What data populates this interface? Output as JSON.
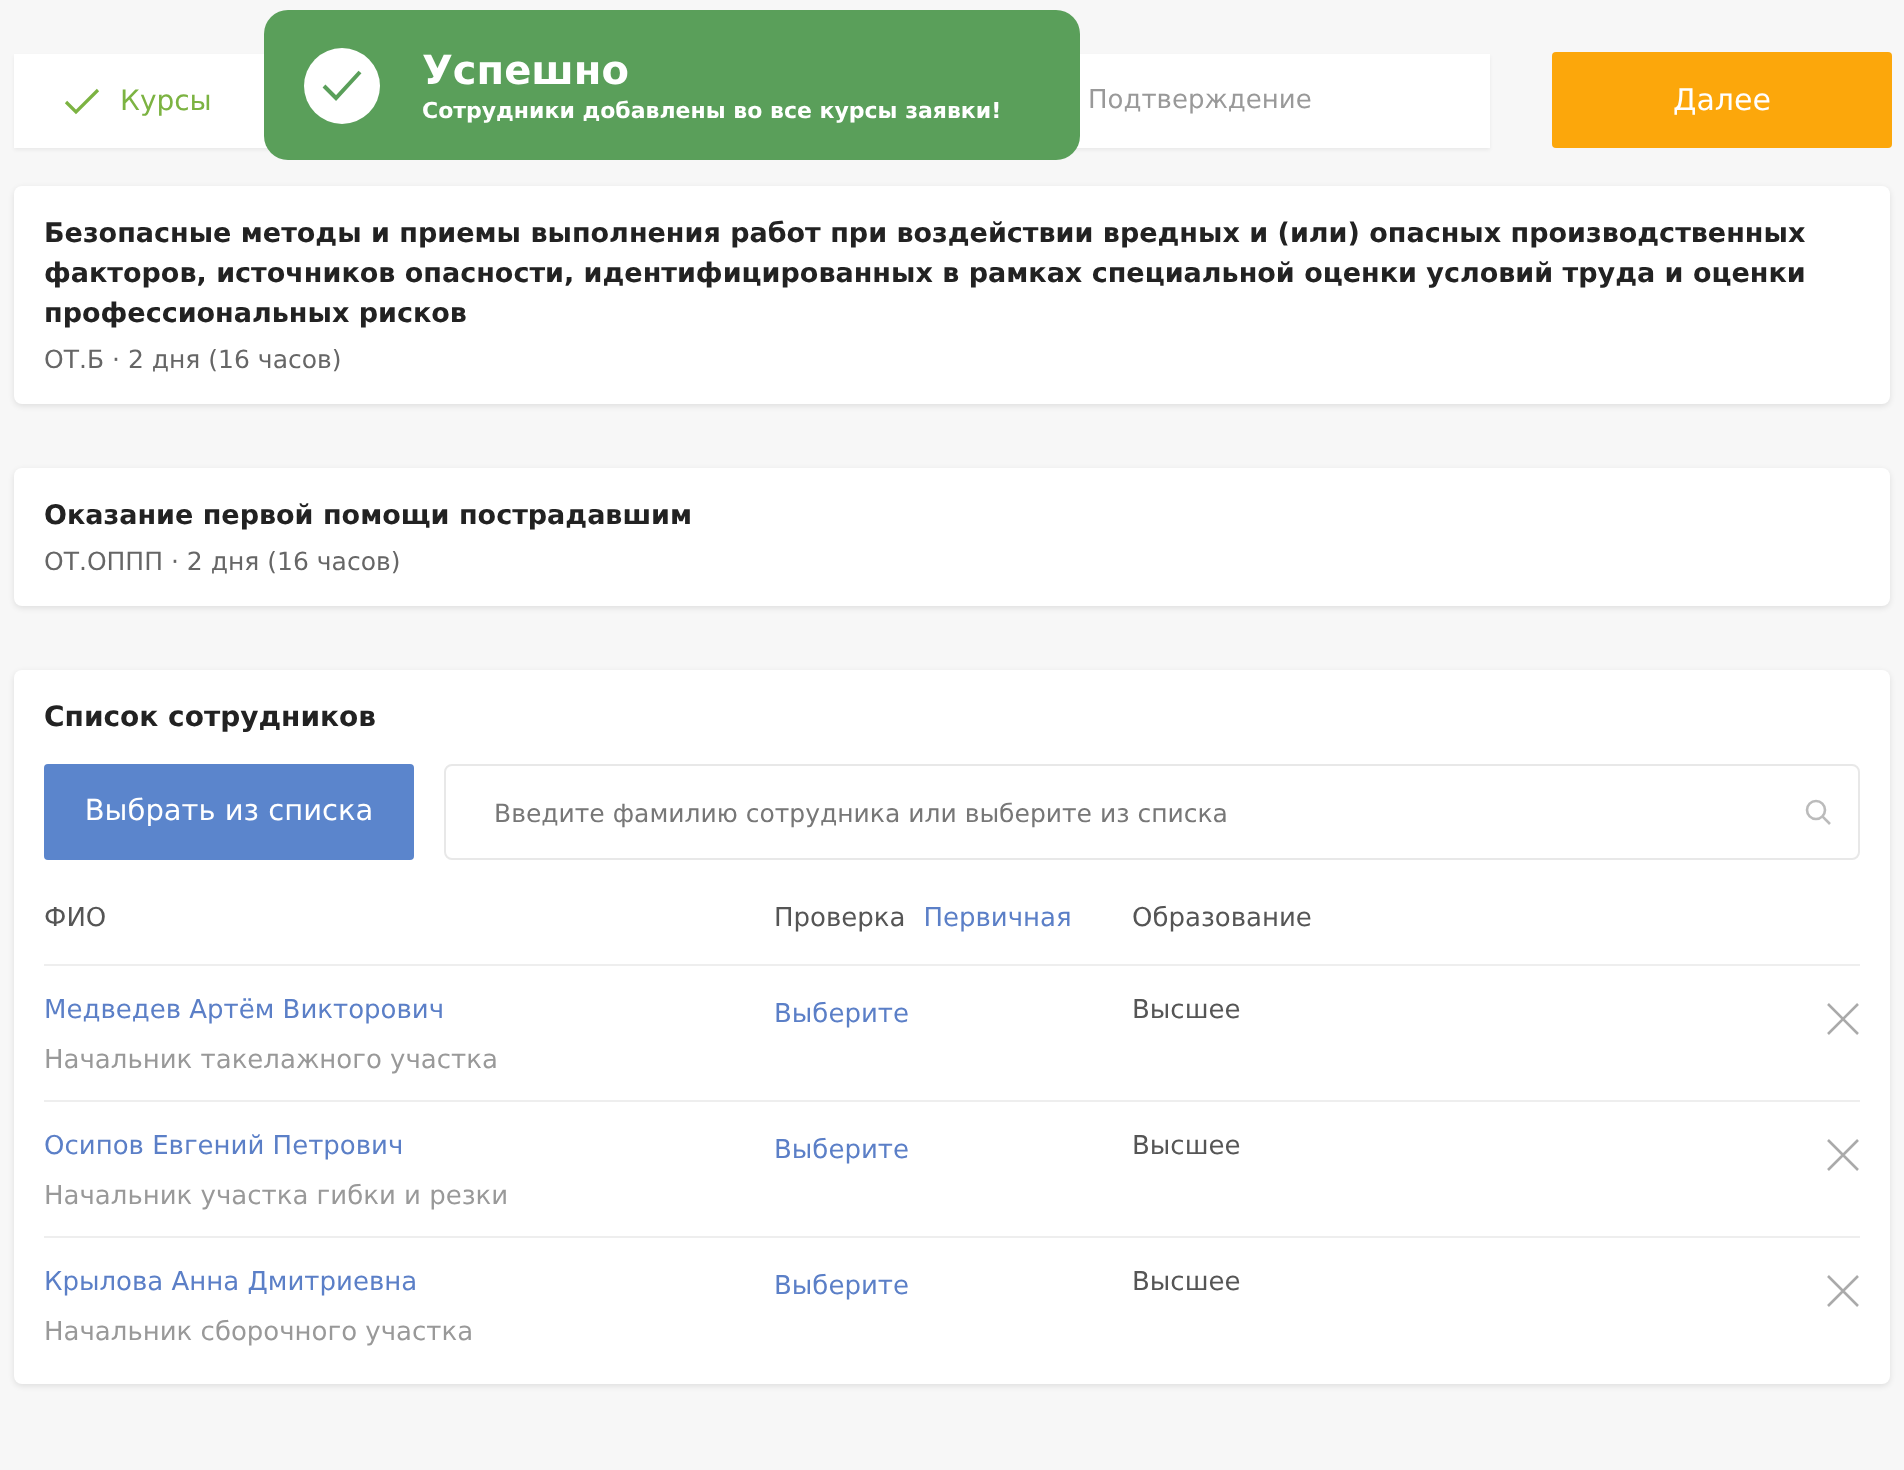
{
  "stepper": {
    "steps": [
      {
        "label": "Курсы",
        "kind": "done"
      },
      {
        "label": "Подтверждение",
        "kind": "pending"
      }
    ]
  },
  "next_button": "Далее",
  "toast": {
    "title": "Успешно",
    "message": "Сотрудники добавлены во все курсы заявки!"
  },
  "courses": [
    {
      "title": "Безопасные методы и приемы выполнения работ при воздействии вредных и (или) опасных производственных факторов, источников опасности, идентифицированных в рамках специальной оценки условий труда и оценки профессиональных рисков",
      "meta": "ОТ.Б · 2 дня (16 часов)"
    },
    {
      "title": "Оказание первой помощи пострадавшим",
      "meta": "ОТ.ОППП · 2 дня (16 часов)"
    }
  ],
  "employees": {
    "title": "Список сотрудников",
    "pick_button": "Выбрать из списка",
    "search": {
      "placeholder": "Введите фамилию сотрудника или выберите из списка"
    },
    "columns": {
      "name": "ФИО",
      "check": "Проверка",
      "check_value": "Первичная",
      "education": "Образование"
    },
    "rows": [
      {
        "name": "Медведев Артём Викторович",
        "position": "Начальник такелажного участка",
        "check": "Выберите",
        "education": "Высшее"
      },
      {
        "name": "Осипов Евгений Петрович",
        "position": "Начальник участка гибки и резки",
        "check": "Выберите",
        "education": "Высшее"
      },
      {
        "name": "Крылова Анна Дмитриевна",
        "position": "Начальник сборочного участка",
        "check": "Выберите",
        "education": "Высшее"
      }
    ]
  }
}
